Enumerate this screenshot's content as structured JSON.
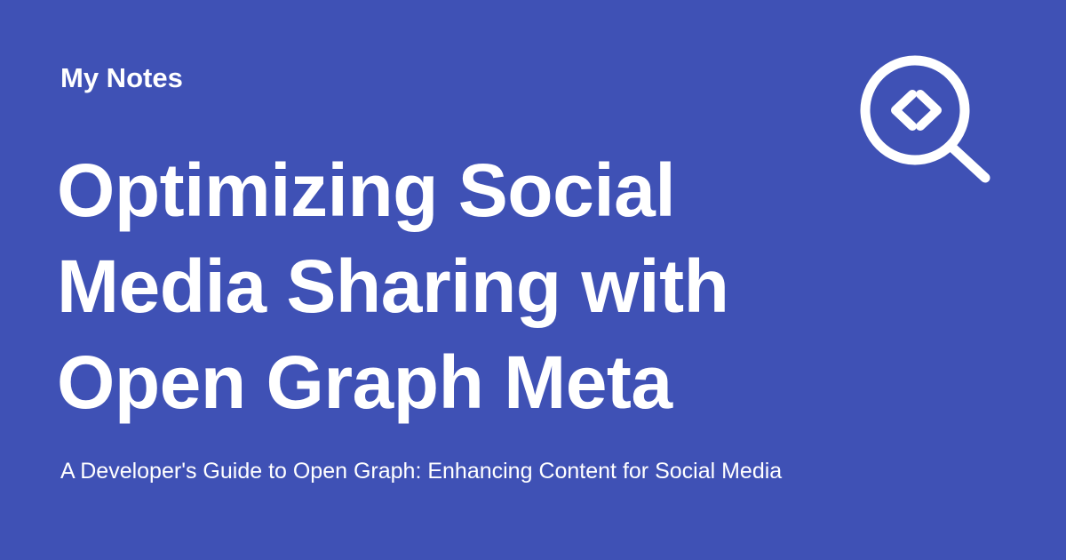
{
  "card": {
    "site_name": "My Notes",
    "title": "Optimizing Social Media Sharing with Open Graph Meta",
    "subtitle": "A Developer's Guide to Open Graph: Enhancing Content for Social Media",
    "logo_icon": "code-search-icon",
    "colors": {
      "background": "#3f51b5",
      "foreground": "#ffffff"
    }
  }
}
